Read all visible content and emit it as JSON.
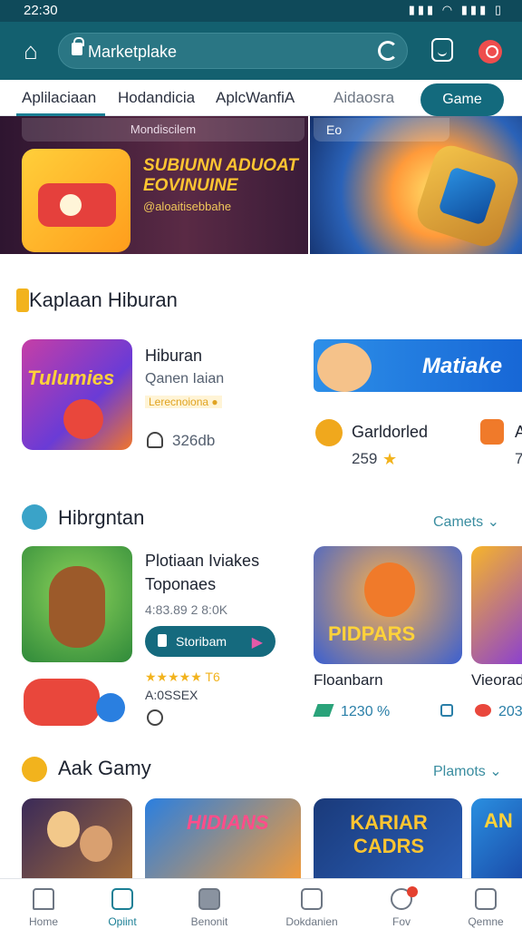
{
  "status": {
    "time": "22:30",
    "icons": "▮▮▮ ◠ ▮▮▮ ▯"
  },
  "search": {
    "text": "Marketplake"
  },
  "tabs": [
    "Aplilaciaan",
    "Hodandicia",
    "AplcWanfiA",
    "Aidaosra"
  ],
  "tab_pill": "Game",
  "hero": {
    "left_chip": "Mondiscilem",
    "headline": "SUBIUNN ADUOAT EOVINUINE",
    "subline": "@aloaitisebbahe",
    "right_chip": "Eo"
  },
  "section1": {
    "title": "Kaplaan Hiburan",
    "app1": {
      "name": "Hiburan",
      "sub": "Qanen Iaian",
      "tag": "Lerecnoiona ●",
      "count": "326db",
      "art_text": "Tulumies"
    },
    "app2": {
      "banner_text": "Matiake",
      "name": "Garldorled",
      "rating": "259",
      "name_cut": "A",
      "rating_cut": "7"
    }
  },
  "section2": {
    "title": "Hibrgntan",
    "more": "Camets",
    "app1": {
      "name": "Plotiaan Iviakes",
      "name2": "Toponaes",
      "meta": "4:83.89 2 8:0K",
      "button": "Storibam",
      "stars": "★★★★★ T6",
      "sub": "A:0SSEX"
    },
    "card1": {
      "art_text": "PIDPARS",
      "name": "Floanbarn",
      "price": "1230 %"
    },
    "card2": {
      "name": "Vieorad",
      "price": "203"
    }
  },
  "section3": {
    "title": "Aak Gamy",
    "more": "Plamots",
    "cards": [
      "HIDIANS",
      "KARIAR CADRS",
      "AN"
    ]
  },
  "nav": [
    "Home",
    "Opiint",
    "Benonit",
    "Dokdanien",
    "Fov",
    "Qemne"
  ]
}
